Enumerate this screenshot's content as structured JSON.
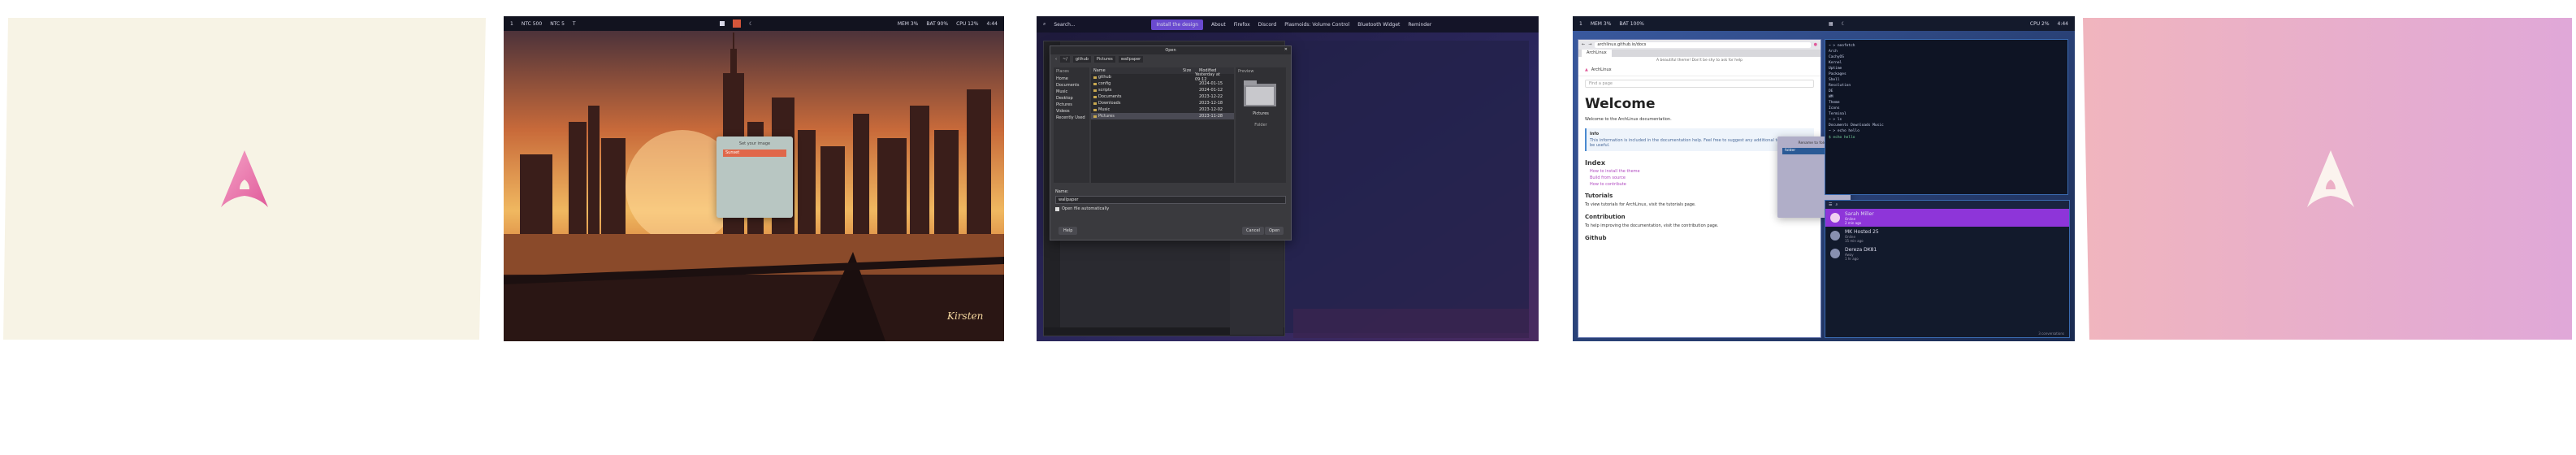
{
  "colors": {
    "accent_pink": "#e05a9a",
    "accent_purple": "#8e35d9",
    "bar_dark": "#1a1e32",
    "cream": "#f7f3e5",
    "pink_bg": "#f0b5be",
    "violet_bg": "#e0a8d8"
  },
  "panel1": {
    "logo": "arch-logo-pink"
  },
  "panel2": {
    "topbar_left": [
      "1",
      "NTC 500",
      "NTC 5",
      "T"
    ],
    "topbar_right": [
      "MEM 3%",
      "BAT 90%",
      "CPU 12%",
      "4:44"
    ],
    "dialog": {
      "title": "Set your image",
      "field_value": "Sunset"
    },
    "signature": "Kirsten"
  },
  "panel3": {
    "topbar": {
      "search_placeholder": "Search...",
      "items": [
        "Install the design",
        "About",
        "Firefox",
        "Discord",
        "Plasmoids: Volume Control",
        "Bluetooth Widget",
        "Reminder"
      ]
    },
    "file_dialog": {
      "title": "Open",
      "path": [
        "~/",
        "github",
        "Pictures",
        "wallpaper"
      ],
      "places_header": "Places",
      "places": [
        "Home",
        "Documents",
        "Music",
        "Desktop",
        "Pictures",
        "Videos",
        "Recently Used"
      ],
      "columns": [
        "Name",
        "Size",
        "Modified"
      ],
      "files": [
        {
          "name": "github",
          "size": "",
          "modified": "Yesterday at 09:12"
        },
        {
          "name": "config",
          "size": "",
          "modified": "2024-01-15"
        },
        {
          "name": "scripts",
          "size": "",
          "modified": "2024-01-12"
        },
        {
          "name": "Documents",
          "size": "",
          "modified": "2023-12-22"
        },
        {
          "name": "Downloads",
          "size": "",
          "modified": "2023-12-18"
        },
        {
          "name": "Music",
          "size": "",
          "modified": "2023-12-02"
        },
        {
          "name": "Pictures",
          "size": "",
          "modified": "2023-11-28"
        }
      ],
      "preview_label": "Preview",
      "preview_name": "Pictures",
      "preview_type": "Folder",
      "filename_label": "Name:",
      "filename_value": "wallpaper",
      "checkbox_label": "Open file automatically",
      "help_label": "Help",
      "cancel_label": "Cancel",
      "open_label": "Open"
    }
  },
  "panel4": {
    "topbar_left": [
      "1",
      "MEM 3%",
      "BAT 100%"
    ],
    "topbar_right": [
      "CPU 2%",
      "4:44"
    ],
    "browser": {
      "url": "archlinux.github.io/docs",
      "tab": "ArchLinux",
      "banner": "A beautiful theme! Don't be shy to ask for help",
      "site_name": "ArchLinux",
      "search_placeholder": "Find a page",
      "heading": "Welcome",
      "intro": "Welcome to the ArchLinux documentation.",
      "note_label": "Info",
      "note_text": "This information is included in the documentation help. Feel free to suggest any additional topics that might be useful.",
      "index_heading": "Index",
      "index_items": [
        "How to install the theme",
        "Build from source",
        "How to contribute"
      ],
      "tutorials_heading": "Tutorials",
      "tutorials_text": "To view tutorials for ArchLinux, visit the tutorials page.",
      "contribution_heading": "Contribution",
      "contribution_text": "To help improving the documentation, visit the contribution page.",
      "github_heading": "Github"
    },
    "dialog": {
      "title": "Rename to folder",
      "field_value": "folder"
    },
    "terminal": {
      "lines": [
        "~ > neofetch",
        "Arch",
        "CachyOS",
        "Kernel",
        "Uptime",
        "Packages",
        "Shell",
        "Resolution",
        "DE",
        "WM",
        "Theme",
        "Icons",
        "Terminal",
        "~ > ls",
        "Documents Downloads Music",
        "~ > echo hello"
      ],
      "prompt": "$ echo hello"
    },
    "contacts": [
      {
        "name": "Sarah Miller",
        "status": "Online",
        "time": "2 min ago",
        "active": true
      },
      {
        "name": "MK Hosted 25",
        "status": "Online",
        "time": "15 min ago",
        "active": false
      },
      {
        "name": "Dereza DK81",
        "status": "Away",
        "time": "1 hr ago",
        "active": false
      }
    ],
    "footer": "3 conversations"
  },
  "panel5": {
    "logo": "arch-logo-white"
  }
}
